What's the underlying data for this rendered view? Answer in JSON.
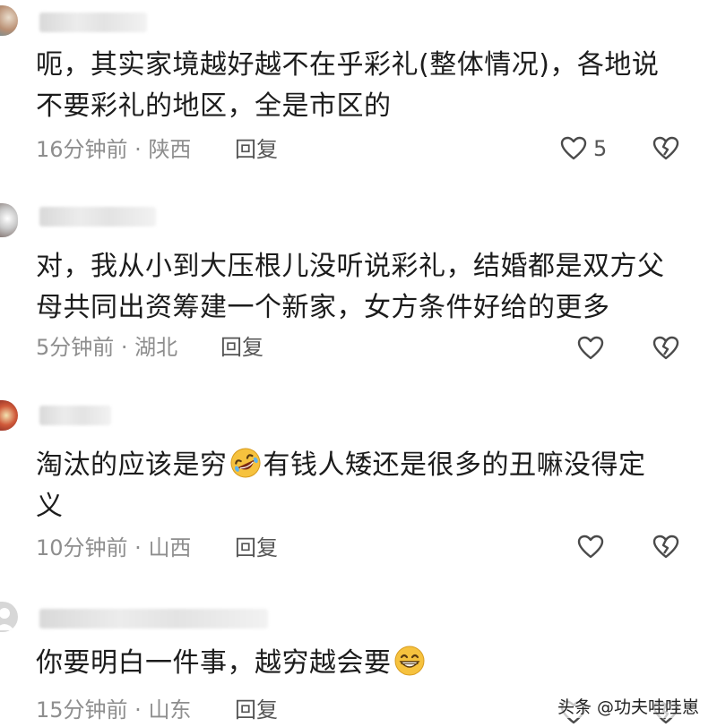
{
  "comments": [
    {
      "text_lines": [
        "呃，其实家境越好越不在乎彩礼(整体情况)，各地说",
        "不要彩礼的地区，全是市区的"
      ],
      "time": "16分钟前",
      "location": "陕西",
      "reply_label": "回复",
      "likes": "5"
    },
    {
      "text_lines": [
        "对，我从小到大压根儿没听说彩礼，结婚都是双方父",
        "母共同出资筹建一个新家，女方条件好给的更多"
      ],
      "time": "5分钟前",
      "location": "湖北",
      "reply_label": "回复",
      "likes": ""
    },
    {
      "text_before_emoji": "淘汰的应该是穷",
      "emoji": "rolling-laughing-emoji",
      "text_after_emoji": "有钱人矮还是很多的丑嘛没得定",
      "text_line2": "义",
      "time": "10分钟前",
      "location": "山西",
      "reply_label": "回复",
      "likes": ""
    },
    {
      "text_before_emoji": "你要明白一件事，越穷越会要",
      "emoji": "grinning-emoji",
      "time": "15分钟前",
      "location": "山东",
      "reply_label": "回复",
      "likes": ""
    }
  ],
  "separator": " · ",
  "icons": {
    "like": "heart-outline-icon",
    "dislike": "broken-heart-icon"
  },
  "watermark": "头条 @功夫哇哇崽",
  "colors": {
    "text": "#1c1c1c",
    "meta": "#8e8e8e",
    "icon": "#4a4a4a",
    "emoji_face": "#f6c23e"
  }
}
